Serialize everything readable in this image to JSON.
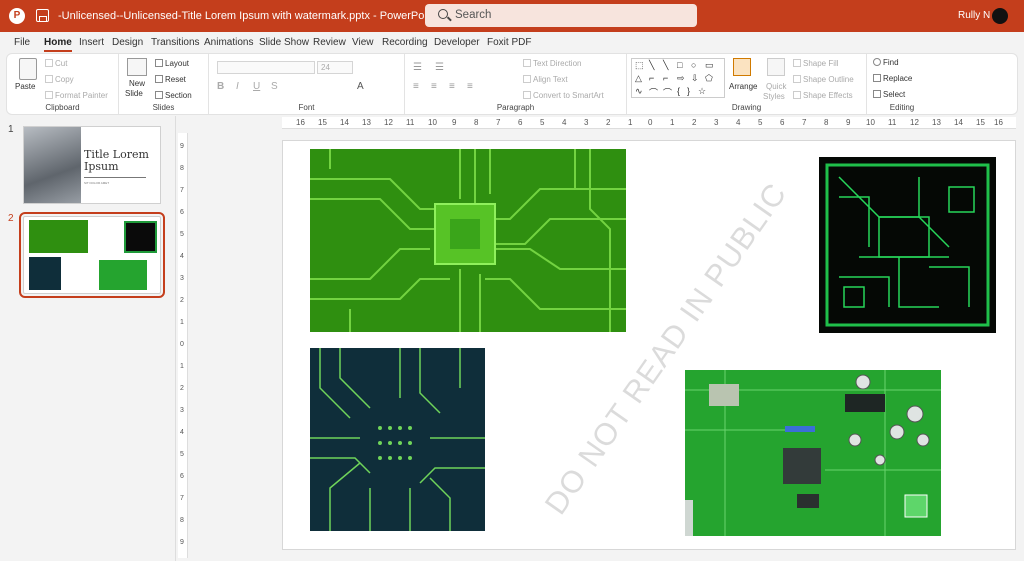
{
  "titlebar": {
    "doc_title": "-Unlicensed--Unlicensed-Title Lorem Ipsum with watermark.pptx  -  PowerPoint",
    "search_placeholder": "Search",
    "user_name": "Rully N",
    "logo_letter": "P"
  },
  "menu": [
    "File",
    "Home",
    "Insert",
    "Design",
    "Transitions",
    "Animations",
    "Slide Show",
    "Review",
    "View",
    "Recording",
    "Developer",
    "Foxit PDF"
  ],
  "active_tab": "Home",
  "ribbon": {
    "clipboard": {
      "paste": "Paste",
      "cut": "Cut",
      "copy": "Copy",
      "format_painter": "Format Painter",
      "label": "Clipboard"
    },
    "slides": {
      "new_slide": "New",
      "new_slide_2": "Slide",
      "layout": "Layout",
      "reset": "Reset",
      "section": "Section",
      "label": "Slides"
    },
    "font": {
      "size": "24",
      "label": "Font"
    },
    "paragraph": {
      "text_direction": "Text Direction",
      "align_text": "Align Text",
      "convert_smartart": "Convert to SmartArt",
      "label": "Paragraph"
    },
    "drawing": {
      "arrange": "Arrange",
      "quick_styles_1": "Quick",
      "quick_styles_2": "Styles",
      "shape_fill": "Shape Fill",
      "shape_outline": "Shape Outline",
      "shape_effects": "Shape Effects",
      "label": "Drawing"
    },
    "editing": {
      "find": "Find",
      "replace": "Replace",
      "select": "Select",
      "label": "Editing"
    }
  },
  "slides_pane": {
    "slide1": {
      "number": "1",
      "title_line1": "Title Lorem",
      "title_line2": "Ipsum",
      "subtitle": "SIT DOLOR AMET"
    },
    "slide2": {
      "number": "2"
    }
  },
  "ruler_h": [
    "16",
    "15",
    "14",
    "13",
    "12",
    "11",
    "10",
    "9",
    "8",
    "7",
    "6",
    "5",
    "4",
    "3",
    "2",
    "1",
    "0",
    "1",
    "2",
    "3",
    "4",
    "5",
    "6",
    "7",
    "8",
    "9",
    "10",
    "11",
    "12",
    "13",
    "14",
    "15",
    "16"
  ],
  "ruler_v": [
    "9",
    "8",
    "7",
    "6",
    "5",
    "4",
    "3",
    "2",
    "1",
    "0",
    "1",
    "2",
    "3",
    "4",
    "5",
    "6",
    "7",
    "8",
    "9"
  ],
  "slide": {
    "watermark": "DO NOT READ IN PUBLIC"
  },
  "colors": {
    "accent": "#c43e1c",
    "pcb_green": "#2f8f10",
    "pcb_navy": "#0f2e3a"
  }
}
